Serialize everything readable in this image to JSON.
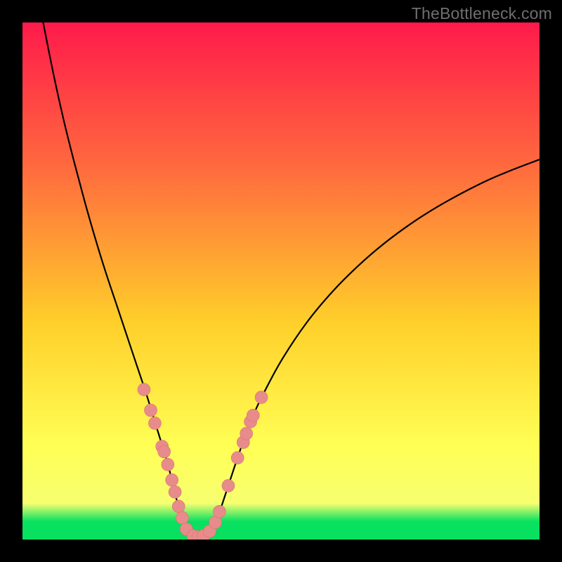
{
  "watermark": "TheBottleneck.com",
  "colors": {
    "frame": "#000000",
    "curve": "#000000",
    "marker_fill": "#e88b8b",
    "marker_stroke": "#d97272",
    "grad_top": "#ff1a4b",
    "grad_mid1": "#ff6a3e",
    "grad_mid2": "#ffcf2a",
    "grad_mid3": "#ffff55",
    "grad_bottom_y": "#f7ff70",
    "grad_green": "#08e060"
  },
  "chart_data": {
    "type": "line",
    "title": "",
    "xlabel": "",
    "ylabel": "",
    "xlim": [
      0,
      100
    ],
    "ylim": [
      0,
      100
    ],
    "curve": {
      "left_branch": [
        {
          "x": 4.0,
          "y": 100.0
        },
        {
          "x": 6.0,
          "y": 90.0
        },
        {
          "x": 8.0,
          "y": 81.0
        },
        {
          "x": 10.0,
          "y": 73.0
        },
        {
          "x": 12.0,
          "y": 65.5
        },
        {
          "x": 14.0,
          "y": 58.5
        },
        {
          "x": 16.0,
          "y": 52.0
        },
        {
          "x": 18.0,
          "y": 46.0
        },
        {
          "x": 20.0,
          "y": 40.0
        },
        {
          "x": 22.0,
          "y": 34.0
        },
        {
          "x": 24.0,
          "y": 28.0
        },
        {
          "x": 26.0,
          "y": 21.5
        },
        {
          "x": 28.0,
          "y": 15.0
        },
        {
          "x": 29.0,
          "y": 11.0
        },
        {
          "x": 30.0,
          "y": 7.0
        },
        {
          "x": 31.0,
          "y": 3.5
        },
        {
          "x": 32.0,
          "y": 1.5
        },
        {
          "x": 33.0,
          "y": 0.6
        },
        {
          "x": 34.0,
          "y": 0.5
        }
      ],
      "right_branch": [
        {
          "x": 34.0,
          "y": 0.5
        },
        {
          "x": 35.0,
          "y": 0.6
        },
        {
          "x": 36.0,
          "y": 1.2
        },
        {
          "x": 37.0,
          "y": 2.6
        },
        {
          "x": 38.0,
          "y": 5.0
        },
        {
          "x": 40.0,
          "y": 11.0
        },
        {
          "x": 42.0,
          "y": 17.0
        },
        {
          "x": 44.0,
          "y": 22.5
        },
        {
          "x": 46.0,
          "y": 27.0
        },
        {
          "x": 50.0,
          "y": 34.5
        },
        {
          "x": 55.0,
          "y": 42.0
        },
        {
          "x": 60.0,
          "y": 48.0
        },
        {
          "x": 65.0,
          "y": 53.0
        },
        {
          "x": 70.0,
          "y": 57.3
        },
        {
          "x": 75.0,
          "y": 61.0
        },
        {
          "x": 80.0,
          "y": 64.2
        },
        {
          "x": 85.0,
          "y": 67.0
        },
        {
          "x": 90.0,
          "y": 69.5
        },
        {
          "x": 95.0,
          "y": 71.6
        },
        {
          "x": 100.0,
          "y": 73.5
        }
      ]
    },
    "markers": [
      {
        "x": 23.5,
        "y": 29.0
      },
      {
        "x": 24.8,
        "y": 25.0
      },
      {
        "x": 25.6,
        "y": 22.5
      },
      {
        "x": 27.0,
        "y": 18.0
      },
      {
        "x": 27.4,
        "y": 17.0
      },
      {
        "x": 28.1,
        "y": 14.5
      },
      {
        "x": 28.9,
        "y": 11.5
      },
      {
        "x": 29.5,
        "y": 9.2
      },
      {
        "x": 30.2,
        "y": 6.4
      },
      {
        "x": 30.9,
        "y": 4.2
      },
      {
        "x": 31.7,
        "y": 2.0
      },
      {
        "x": 33.0,
        "y": 0.7
      },
      {
        "x": 34.0,
        "y": 0.5
      },
      {
        "x": 35.0,
        "y": 0.7
      },
      {
        "x": 36.2,
        "y": 1.6
      },
      {
        "x": 37.3,
        "y": 3.3
      },
      {
        "x": 38.1,
        "y": 5.4
      },
      {
        "x": 39.8,
        "y": 10.4
      },
      {
        "x": 41.6,
        "y": 15.8
      },
      {
        "x": 42.7,
        "y": 18.8
      },
      {
        "x": 43.3,
        "y": 20.5
      },
      {
        "x": 44.1,
        "y": 22.8
      },
      {
        "x": 44.6,
        "y": 24.0
      },
      {
        "x": 46.2,
        "y": 27.5
      }
    ],
    "marker_radius_px": 9,
    "gradient_stops": [
      {
        "offset": 0.0,
        "key": "grad_top"
      },
      {
        "offset": 0.28,
        "key": "grad_mid1"
      },
      {
        "offset": 0.58,
        "key": "grad_mid2"
      },
      {
        "offset": 0.82,
        "key": "grad_mid3"
      },
      {
        "offset": 0.93,
        "key": "grad_bottom_y"
      },
      {
        "offset": 0.965,
        "key": "grad_green"
      },
      {
        "offset": 1.0,
        "key": "grad_green"
      }
    ]
  }
}
